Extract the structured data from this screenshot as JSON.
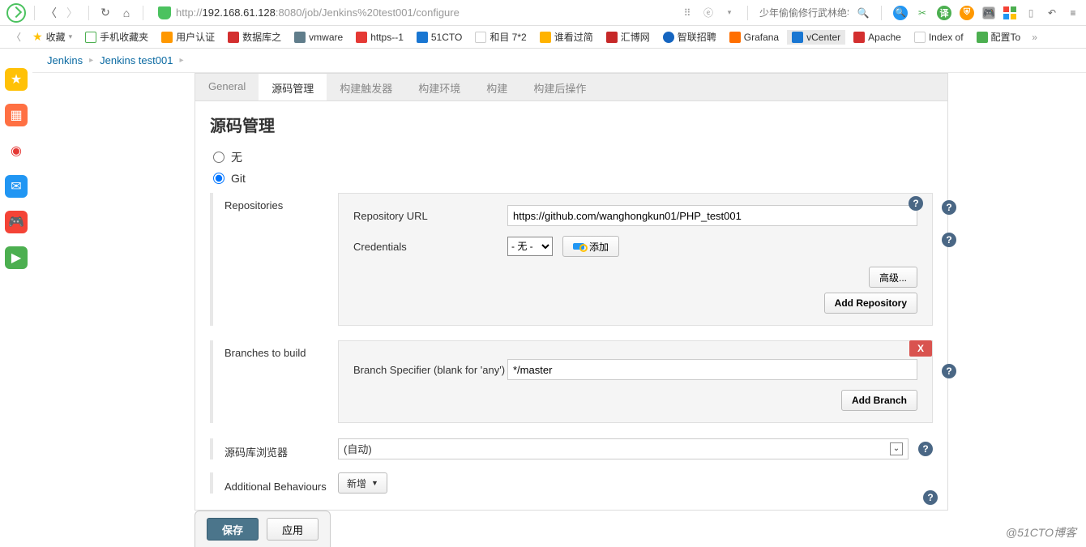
{
  "browser": {
    "url_prefix": "http://",
    "url_host": "192.168.61.128",
    "url_port_path": ":8080/job/Jenkins%20test001/configure",
    "search_placeholder": "少年偷偷修行武林绝学"
  },
  "bookmarks": {
    "fav": "收藏",
    "items": [
      "手机收藏夹",
      "用户认证",
      "数据库之",
      "vmware",
      "https--1",
      "51CTO",
      "和目 7*2",
      "谁看过简",
      "汇博网",
      "智联招聘",
      "Grafana",
      "vCenter",
      "Apache",
      "Index of",
      "配置To"
    ]
  },
  "breadcrumb": {
    "root": "Jenkins",
    "job": "Jenkins test001"
  },
  "tabs": [
    "General",
    "源码管理",
    "构建触发器",
    "构建环境",
    "构建",
    "构建后操作"
  ],
  "section_title": "源码管理",
  "scm": {
    "none_label": "无",
    "git_label": "Git",
    "repos_label": "Repositories",
    "repo_url_label": "Repository URL",
    "repo_url_value": "https://github.com/wanghongkun01/PHP_test001",
    "cred_label": "Credentials",
    "cred_none": "- 无 -",
    "add_btn": "添加",
    "advanced_btn": "高级...",
    "add_repo_btn": "Add Repository",
    "branches_label": "Branches to build",
    "branch_spec_label": "Branch Specifier (blank for 'any')",
    "branch_value": "*/master",
    "add_branch_btn": "Add Branch",
    "delete_x": "X",
    "repo_browser_label": "源码库浏览器",
    "repo_browser_value": "(自动)",
    "additional_label": "Additional Behaviours",
    "add_beh_btn": "新增"
  },
  "buttons": {
    "save": "保存",
    "apply": "应用"
  },
  "watermark": "@51CTO博客"
}
